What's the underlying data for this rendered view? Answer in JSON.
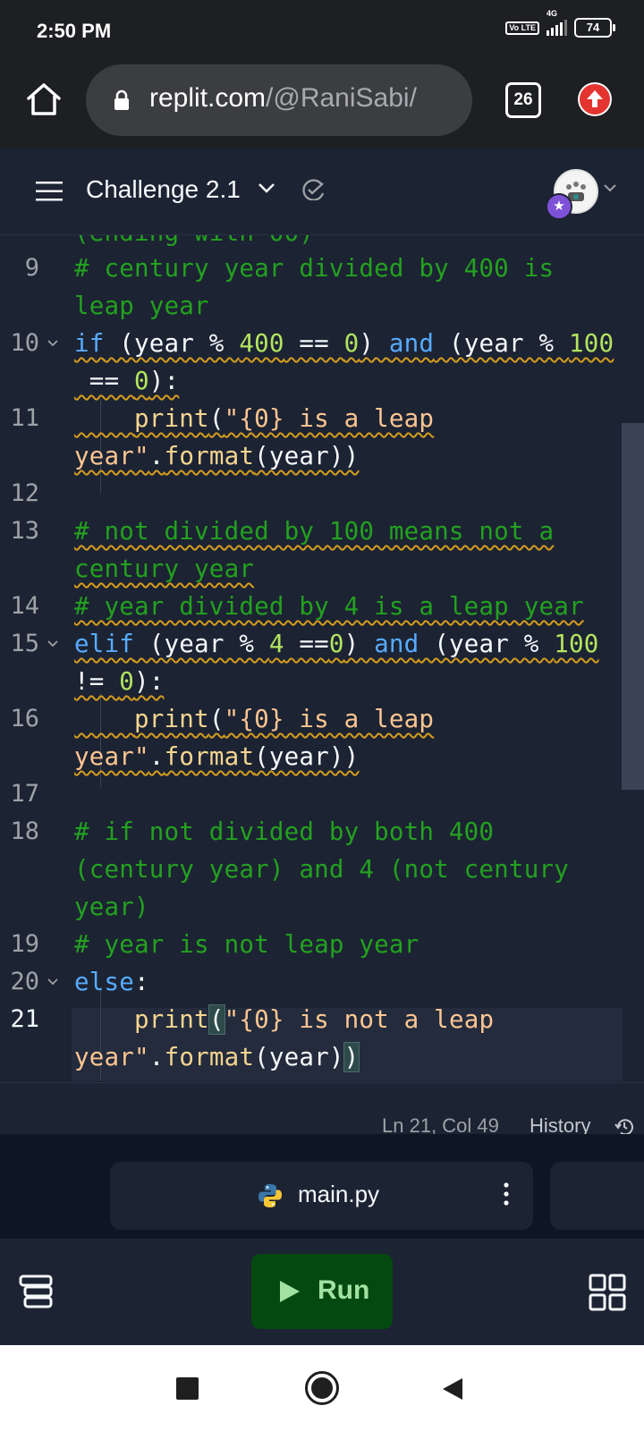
{
  "status_bar": {
    "time": "2:50 PM",
    "volte": "Vo LTE",
    "network": "4G",
    "battery": "74"
  },
  "browser": {
    "url_host": "replit.com",
    "url_path": "/@RaniSabi/",
    "tab_count": "26"
  },
  "repl": {
    "title": "Challenge 2.1"
  },
  "editor": {
    "partial_top_line": "(ending with 00)",
    "line_numbers": [
      "9",
      "10",
      "11",
      "12",
      "13",
      "14",
      "15",
      "16",
      "17",
      "18",
      "19",
      "20",
      "21"
    ]
  },
  "status": {
    "cursor": "Ln 21, Col 49",
    "history_label": "History"
  },
  "file_tab": {
    "name": "main.py"
  },
  "toolbar": {
    "run_label": "Run"
  },
  "colors": {
    "editor_bg": "#1c2333",
    "comment": "#23a11f",
    "keyword": "#57abff",
    "string": "#fcc591",
    "number": "#b3e45f",
    "run_bg": "#044a10",
    "run_text": "#a1e1a1"
  }
}
